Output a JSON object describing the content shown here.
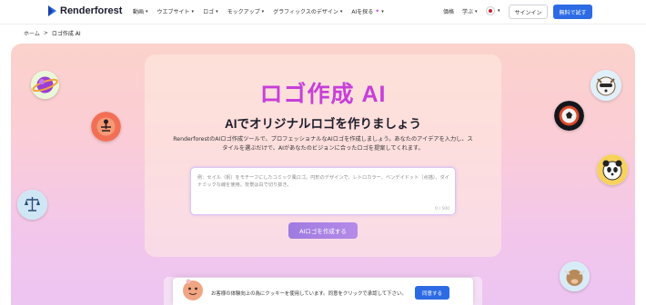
{
  "header": {
    "brand": "Renderforest",
    "nav": [
      {
        "label": "動画",
        "caret": "▾"
      },
      {
        "label": "ウエブサイト",
        "caret": "▾"
      },
      {
        "label": "ロゴ",
        "caret": "▾"
      },
      {
        "label": "モックアップ",
        "caret": "▾"
      },
      {
        "label": "グラフィックスのデザイン",
        "caret": "▾"
      },
      {
        "label": "AIを探る",
        "caret": "▾"
      }
    ],
    "pricing": "価格",
    "learn": "学ぶ",
    "signin": "サインイン",
    "trial": "無料で試す"
  },
  "breadcrumb": {
    "home": "ホーム",
    "separator": ">",
    "current": "ロゴ作成 AI"
  },
  "hero": {
    "title": "ロゴ作成 AI",
    "subtitle": "AIでオリジナルロゴを作りましょう",
    "description": "RenderforestのAIロゴ作成ツールで、プロフェッショナルなAIロゴを作成しましょう。あなたのアイデアを入力し、スタイルを選ぶだけで、AIがあなたのビジョンに合ったロゴを提案してくれます。",
    "prompt_placeholder": "例：セイル（帆）をモチーフにしたコミック風ロゴ。円形のデザインで、レトロカラー、ベンデイドット（点描）、ダイナミックな線を使用。背景は白で切り抜き。",
    "counter": "0 / 500",
    "create_button": "AIロゴを作成する"
  },
  "cookie": {
    "text": "お客様の体験向上の為にクッキーを使用しています。同意をクリックで承認して下さい。",
    "agree": "同意する"
  },
  "colors": {
    "accent": "#2d6be4",
    "title": "#c73fd8",
    "button": "#a880e4"
  }
}
